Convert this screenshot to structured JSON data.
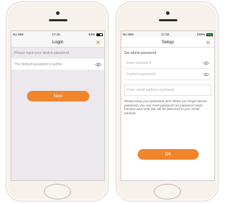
{
  "login_screen": {
    "status": {
      "carrier": "No SIM",
      "time": "17:16",
      "battery_text": "63%",
      "battery_level": 0.63
    },
    "title": "Login",
    "hint": "Please input your device password.",
    "password_placeholder": "The default password is admin",
    "next_label": "Next",
    "icons": {
      "close": "close-icon",
      "eye": "eye-icon"
    },
    "accent": "#f0862c"
  },
  "setup_screen": {
    "status": {
      "carrier": "No SIM",
      "time": "17:15",
      "battery_text": "100%",
      "battery_level": 1.0
    },
    "title": "Setup",
    "section_label": "Set admin password",
    "enter_password_placeholder": "Enter password",
    "confirm_password_placeholder": "Confirm password",
    "email_placeholder": "Enter email address (optional)",
    "note": "Please keep your password well. When you forget device password, you can reset password via password reset function and reset link will be delivered to your email address.",
    "ok_label": "OK",
    "icons": {
      "close": "close-icon",
      "eye": "eye-icon"
    },
    "accent": "#f0862c"
  }
}
